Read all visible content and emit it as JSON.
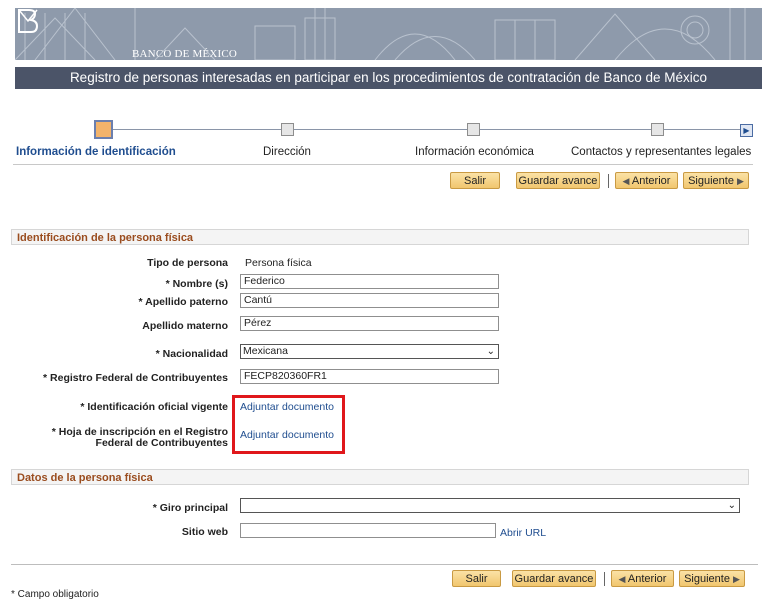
{
  "header": {
    "bank_name": "BANCO DE MÉXICO",
    "title": "Registro de personas interesadas en participar en los procedimientos de contratación de Banco de México"
  },
  "steps": [
    {
      "label": "Información de identificación",
      "active": true
    },
    {
      "label": "Dirección",
      "active": false
    },
    {
      "label": "Información económica",
      "active": false
    },
    {
      "label": "Contactos y representantes legales",
      "active": false
    }
  ],
  "toolbar": {
    "exit_label": "Salir",
    "save_label": "Guardar avance",
    "prev_label": "Anterior",
    "next_label": "Siguiente"
  },
  "person_section": {
    "title": "Identificación de la persona física",
    "tipo_label": "Tipo de persona",
    "tipo_value": "Persona física",
    "nombre_label": "* Nombre (s)",
    "nombre_value": "Federico",
    "paterno_label": "* Apellido paterno",
    "paterno_value": "Cantú",
    "materno_label": "Apellido materno",
    "materno_value": "Pérez",
    "nacionalidad_label": "* Nacionalidad",
    "nacionalidad_value": "Mexicana",
    "rfc_label": "* Registro Federal de Contribuyentes",
    "rfc_value": "FECP820360FR1",
    "id_label": "* Identificación oficial vigente",
    "id_link": "Adjuntar documento",
    "hoja_label_1": "* Hoja de inscripción en el Registro",
    "hoja_label_2": "Federal de Contribuyentes",
    "hoja_link": "Adjuntar documento"
  },
  "datos_section": {
    "title": "Datos de la persona física",
    "giro_label": "* Giro principal",
    "giro_value": "",
    "sitio_label": "Sitio web",
    "sitio_value": "",
    "abrir_url": "Abrir URL"
  },
  "footnote": "* Campo obligatorio",
  "colors": {
    "title_bar": "#4b5468",
    "section_title": "#9a4c1e",
    "link": "#1f4d8f",
    "highlight": "#e0171b",
    "button": "#f1c66e"
  }
}
